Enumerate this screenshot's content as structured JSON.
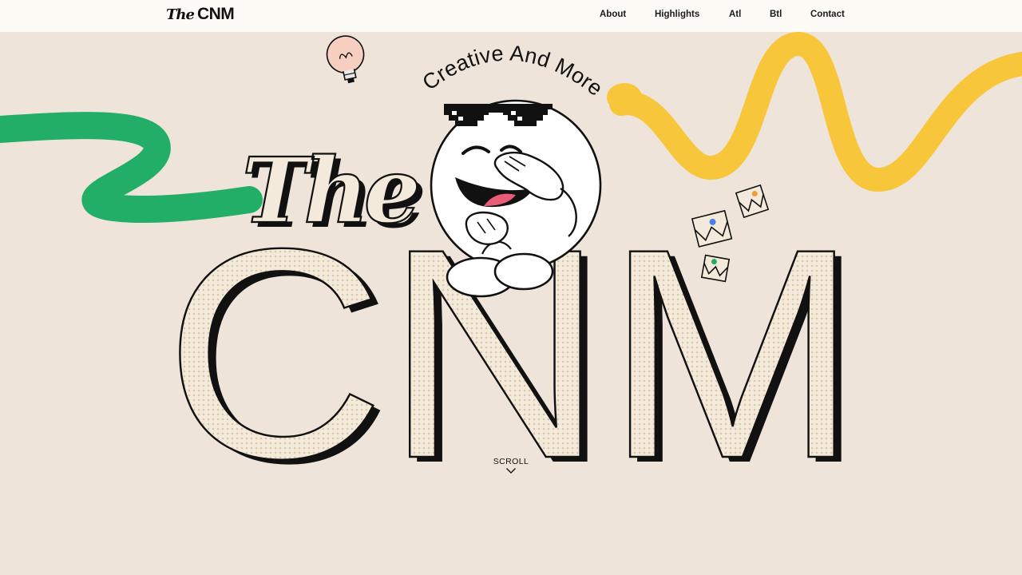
{
  "brand": {
    "logo_the": "The",
    "logo_cnm": "CNM"
  },
  "nav": {
    "items": [
      {
        "label": "About"
      },
      {
        "label": "Highlights"
      },
      {
        "label": "Atl"
      },
      {
        "label": "Btl"
      },
      {
        "label": "Contact"
      }
    ]
  },
  "hero": {
    "tagline": "Creative And More",
    "title_the": "The",
    "title_cnm": "CNM",
    "scroll_label": "SCROLL"
  },
  "colors": {
    "background": "#EEE4D9",
    "nav_background": "#FDFBF6",
    "letter_fill": "#F4EADB",
    "green_squiggle": "#22AE66",
    "yellow_squiggle": "#F7C63B",
    "ink": "#111111"
  },
  "icons": {
    "lightbulb": "lightbulb-icon",
    "mascot": "smiling-ball-mascot",
    "sunglasses": "pixel-sunglasses-icon",
    "envelopes": "envelope-icon",
    "scroll": "chevron-down-icon"
  }
}
